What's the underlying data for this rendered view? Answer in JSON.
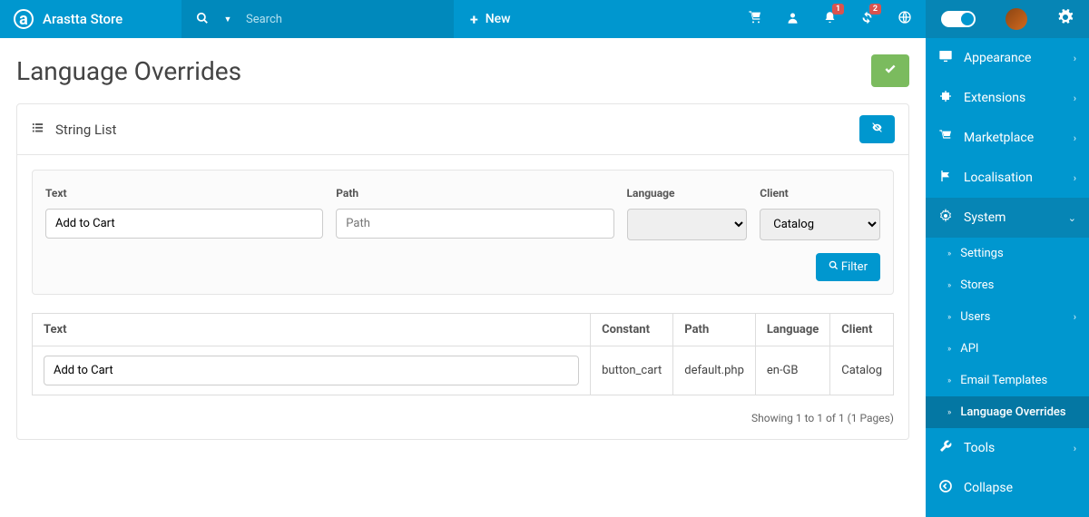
{
  "brand": "Arastta Store",
  "search": {
    "placeholder": "Search"
  },
  "new_btn": "New",
  "badges": {
    "notifications": "1",
    "sync": "2"
  },
  "page_title": "Language Overrides",
  "panel_title": "String List",
  "filter": {
    "text_label": "Text",
    "text_value": "Add to Cart",
    "path_label": "Path",
    "path_placeholder": "Path",
    "language_label": "Language",
    "language_value": "",
    "client_label": "Client",
    "client_value": "Catalog",
    "button": "Filter"
  },
  "table": {
    "headers": {
      "text": "Text",
      "constant": "Constant",
      "path": "Path",
      "language": "Language",
      "client": "Client"
    },
    "rows": [
      {
        "text": "Add to Cart",
        "constant": "button_cart",
        "path": "default.php",
        "language": "en-GB",
        "client": "Catalog"
      }
    ]
  },
  "pagination": "Showing 1 to 1 of 1 (1 Pages)",
  "sidebar": {
    "appearance": "Appearance",
    "extensions": "Extensions",
    "marketplace": "Marketplace",
    "localisation": "Localisation",
    "system": "System",
    "settings": "Settings",
    "stores": "Stores",
    "users": "Users",
    "api": "API",
    "email_templates": "Email Templates",
    "language_overrides": "Language Overrides",
    "tools": "Tools",
    "collapse": "Collapse"
  }
}
